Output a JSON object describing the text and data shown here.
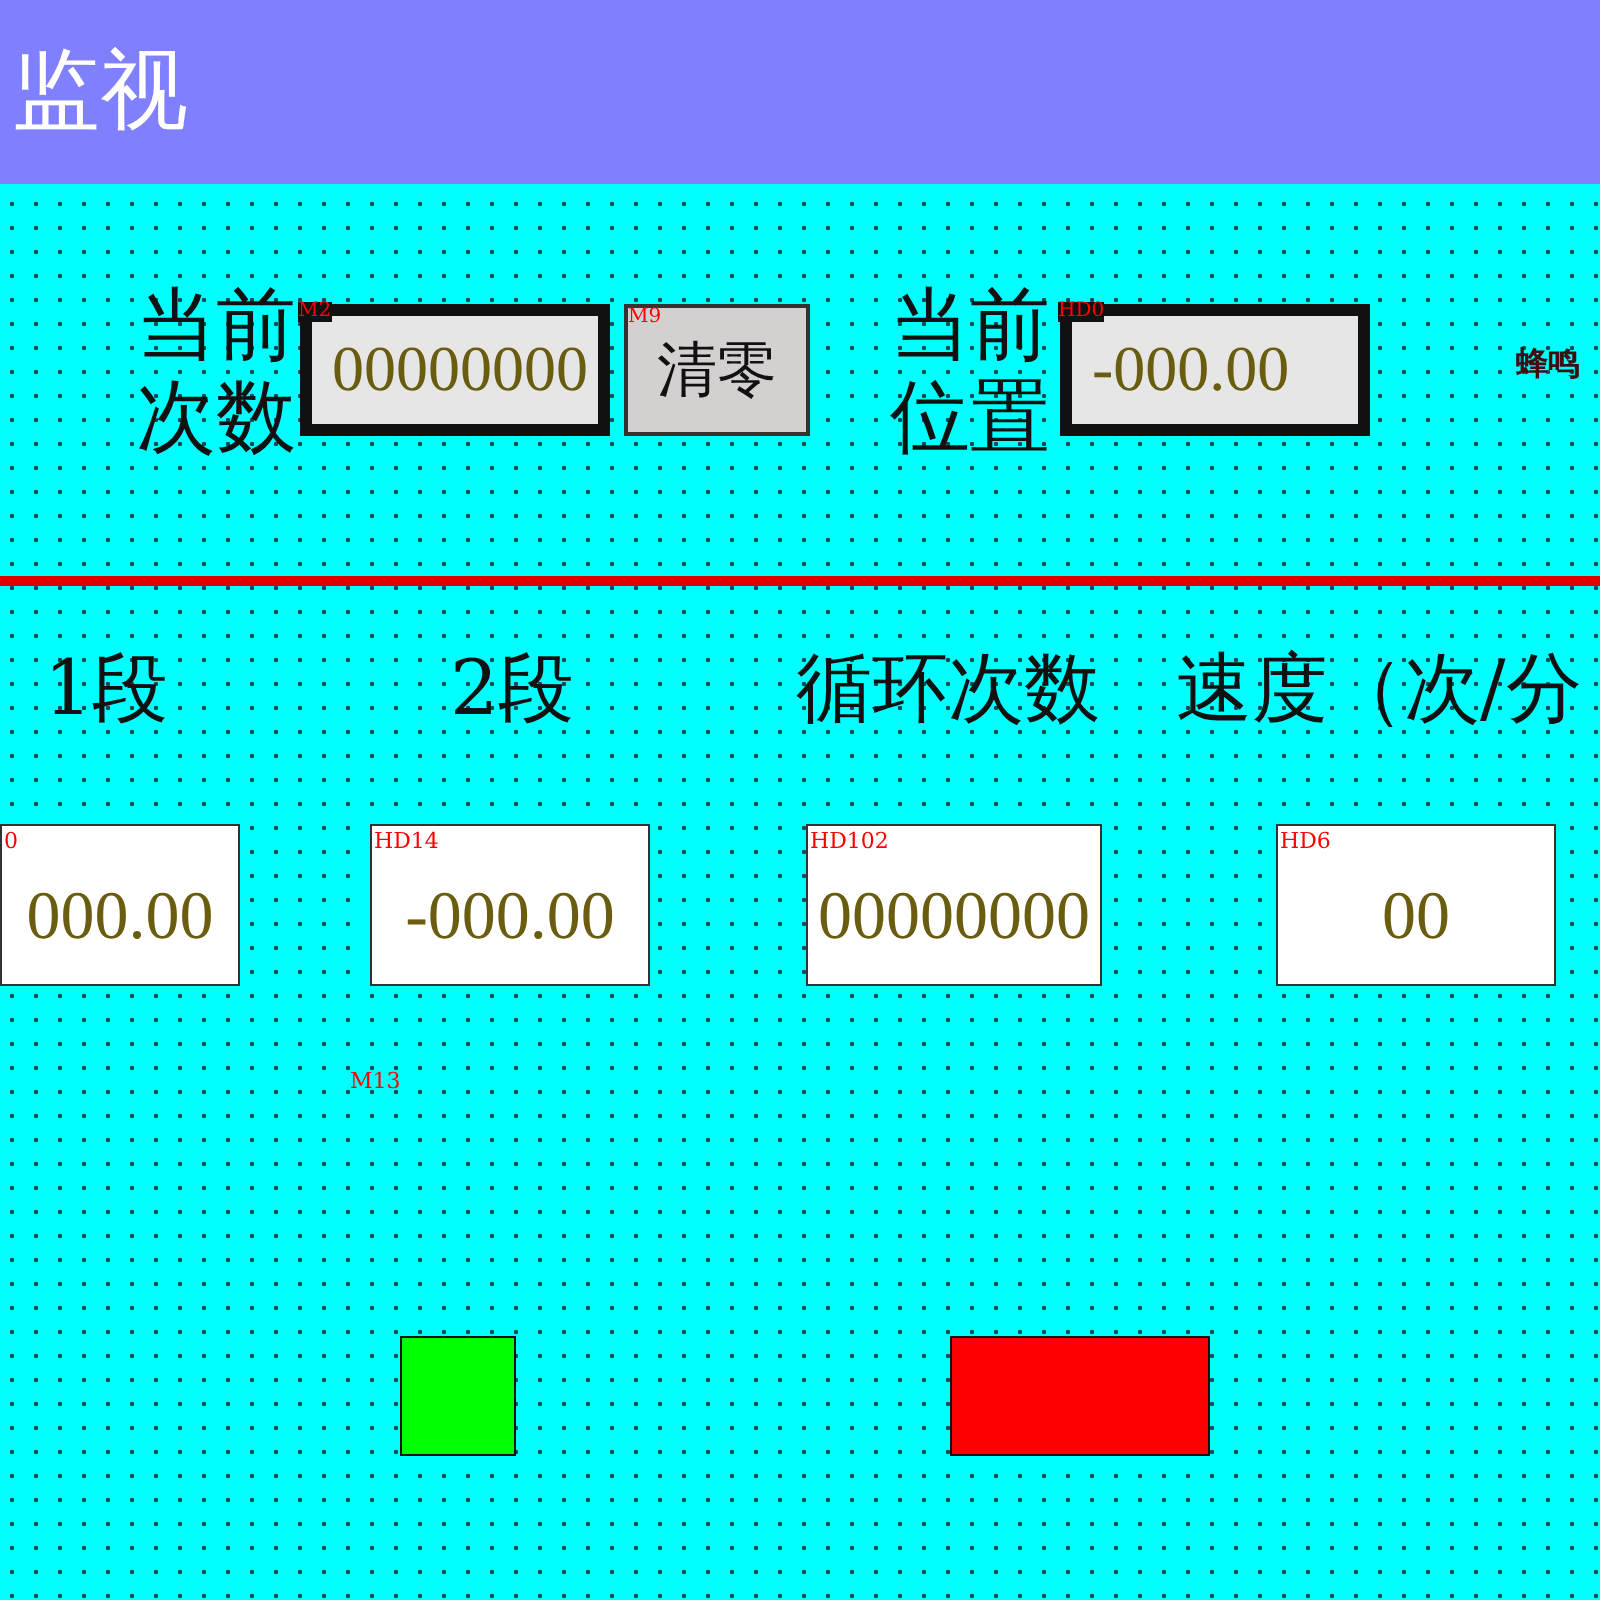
{
  "title_bar": {
    "title": "监视"
  },
  "counter": {
    "label_top": "当前",
    "label_bottom": "次数",
    "tag": "M2",
    "value": "00000000"
  },
  "reset_button": {
    "tag": "M9",
    "label": "清零"
  },
  "position": {
    "label_top": "当前",
    "label_bottom": "位置",
    "tag": "HD0",
    "value": "-000.00"
  },
  "buzzer_label": "蜂鸣",
  "columns": [
    {
      "label": "1段",
      "tag": "0",
      "value": "000.00"
    },
    {
      "label": "2段",
      "tag": "HD14",
      "value": "-000.00"
    },
    {
      "label": "循环次数",
      "tag": "HD102",
      "value": "00000000"
    },
    {
      "label": "速度（次/分",
      "tag": "HD6",
      "value": "00"
    }
  ],
  "bit_tag": "M13",
  "lamps": [
    {
      "color": "#00ff00"
    },
    {
      "color": "#ff0000"
    }
  ]
}
